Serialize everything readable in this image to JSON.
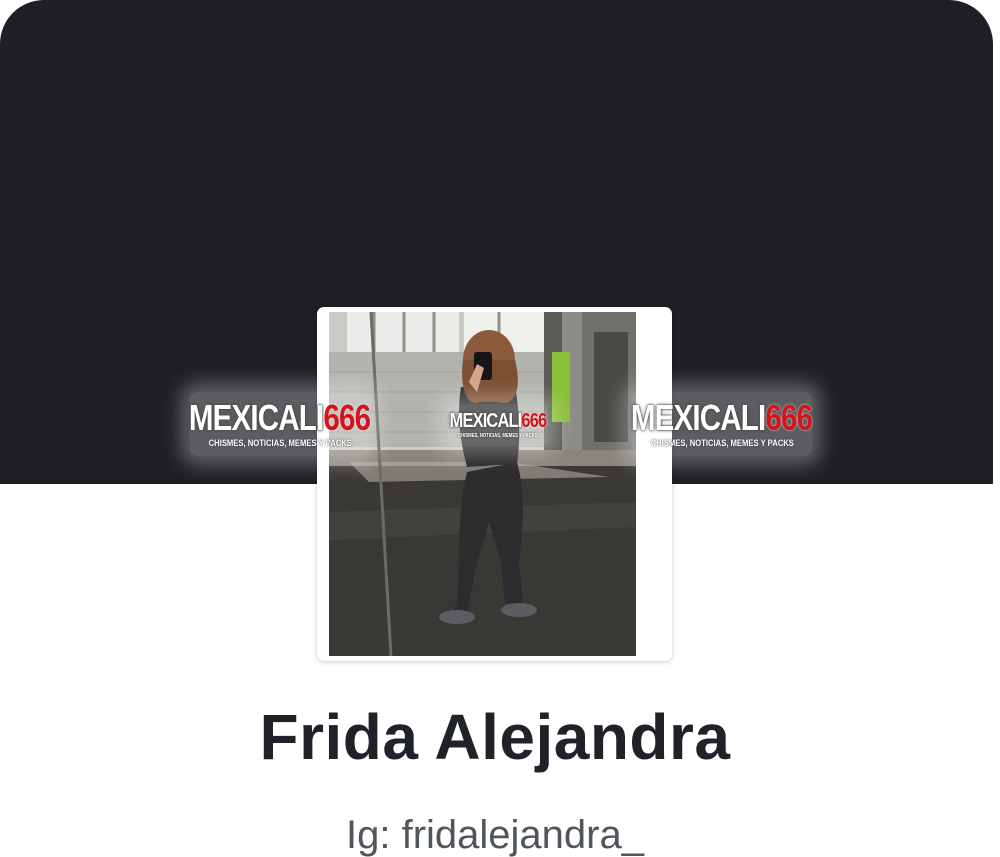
{
  "profile": {
    "name": "Frida Alejandra",
    "bio": "Ig: fridalejandra_"
  },
  "watermark": {
    "brand_white": "MEXICALI",
    "brand_red": "666",
    "tagline": "CHISMES, NOTICIAS, MEMES Y PACKS"
  },
  "colors": {
    "cover": "#1d1f24",
    "name_text": "#1f2228",
    "bio_text": "#50555c",
    "brand_red": "#d4141c"
  }
}
